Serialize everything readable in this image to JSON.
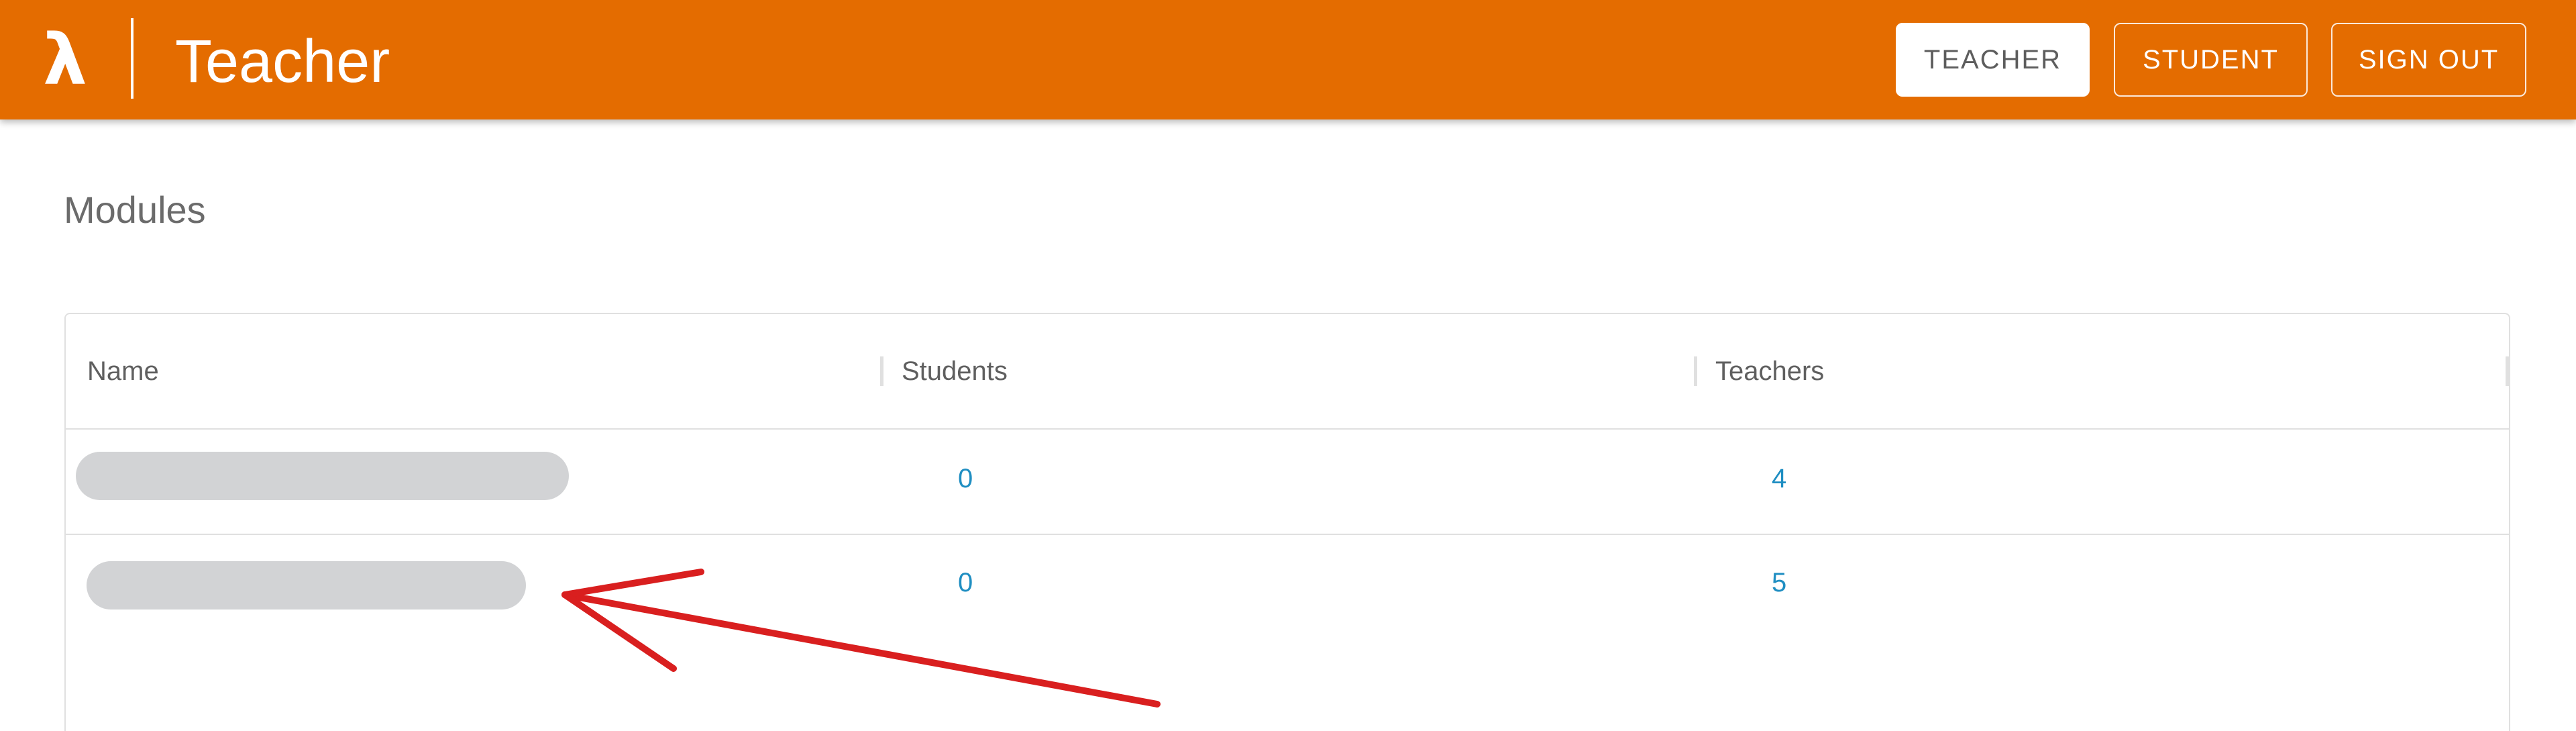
{
  "header": {
    "logo_symbol": "λ",
    "title": "Teacher",
    "nav": {
      "teacher_label": "TEACHER",
      "student_label": "STUDENT",
      "signout_label": "SIGN OUT"
    }
  },
  "page": {
    "heading": "Modules"
  },
  "table": {
    "columns": [
      "Name",
      "Students",
      "Teachers"
    ],
    "rows": [
      {
        "name": "",
        "students": "0",
        "teachers": "4"
      },
      {
        "name": "",
        "students": "0",
        "teachers": "5"
      }
    ]
  },
  "colors": {
    "header_bg": "#e46c00",
    "link": "#1f8ec2",
    "redaction": "#d2d3d5",
    "annotation_arrow": "#d91f1f"
  }
}
